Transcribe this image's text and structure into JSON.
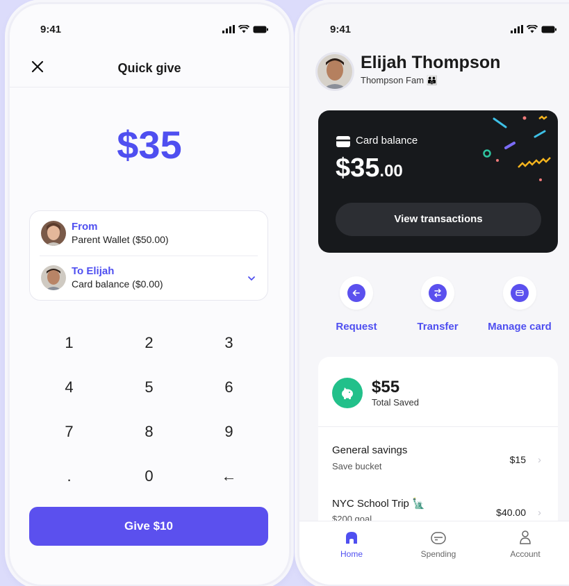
{
  "left_screen": {
    "status_time": "9:41",
    "header_title": "Quick give",
    "amount": "$35",
    "from_label": "From",
    "from_value": "Parent Wallet ($50.00)",
    "to_label": "To Elijah",
    "to_value": "Card balance ($0.00)",
    "keys": [
      "1",
      "2",
      "3",
      "4",
      "5",
      "6",
      "7",
      "8",
      "9",
      ".",
      "0",
      "←"
    ],
    "give_button": "Give $10"
  },
  "right_screen": {
    "status_time": "9:41",
    "profile_name": "Elijah Thompson",
    "profile_family": "Thompson Fam 👪",
    "card_label": "Card balance",
    "card_value_main": "$35",
    "card_value_cents": ".00",
    "view_transactions": "View transactions",
    "actions": [
      {
        "label": "Request",
        "icon": "arrow-left-icon"
      },
      {
        "label": "Transfer",
        "icon": "transfer-icon"
      },
      {
        "label": "Manage card",
        "icon": "card-icon"
      }
    ],
    "total_saved_value": "$55",
    "total_saved_label": "Total Saved",
    "buckets": [
      {
        "name": "General savings",
        "sub": "Save bucket",
        "amount": "$15"
      },
      {
        "name": "NYC School Trip 🗽",
        "sub": "$200 goal",
        "amount": "$40.00"
      }
    ],
    "tabs": [
      {
        "label": "Home",
        "icon": "home-icon",
        "active": true
      },
      {
        "label": "Spending",
        "icon": "card-icon",
        "active": false
      },
      {
        "label": "Account",
        "icon": "person-icon",
        "active": false
      }
    ]
  },
  "colors": {
    "accent": "#5b50ee",
    "accent_text": "#4f4ff0",
    "background": "#dcdcfb",
    "card_dark": "#17191c",
    "savings_green": "#22c08a"
  }
}
